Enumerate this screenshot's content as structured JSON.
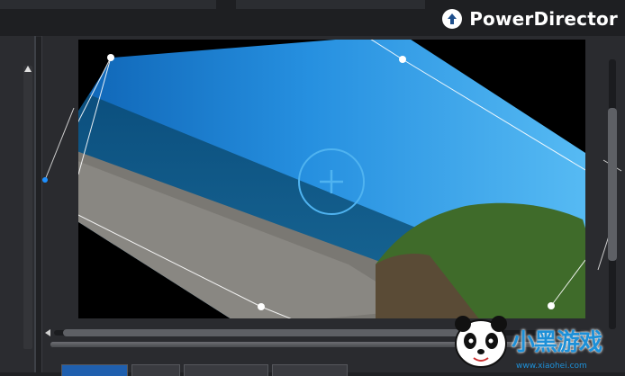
{
  "app": {
    "name": "PowerDirector",
    "icon": "upload-arrow-icon"
  },
  "bottom_tabs": [
    {
      "label": "",
      "active": true
    },
    {
      "label": "",
      "active": false
    },
    {
      "label": "",
      "active": false
    },
    {
      "label": "",
      "active": false
    }
  ],
  "watermark": {
    "text": "小黑游戏",
    "url": "www.xiaohei.com"
  },
  "colors": {
    "accent": "#1d90d8",
    "panel": "#2a2b2f",
    "dark": "#1e1f22"
  }
}
